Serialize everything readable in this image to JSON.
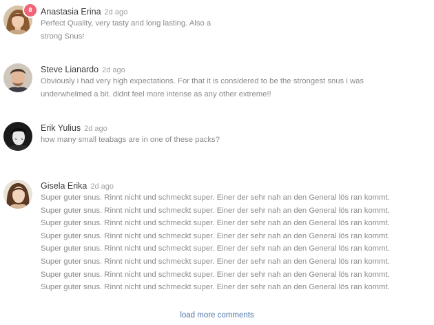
{
  "comments": [
    {
      "author": "Anastasia Erina",
      "time": "2d ago",
      "badge": "8",
      "avatar_icon": "woman-avatar-icon",
      "lines": [
        "Perfect Quality, very tasty and long lasting. Also a",
        "strong Snus!"
      ]
    },
    {
      "author": "Steve Lianardo",
      "time": "2d ago",
      "avatar_icon": "man-avatar-icon",
      "lines": [
        "Obviously i had very high expectations. For that it is considered to be the strongest snus i was",
        "underwhelmed a bit. didnt feel more intense as any other extreme!!"
      ]
    },
    {
      "author": "Erik Yulius",
      "time": "2d ago",
      "avatar_icon": "man-avatar-icon",
      "lines": [
        "how many small teabags are in one of these packs?"
      ]
    },
    {
      "author": "Gisela Erika",
      "time": "2d ago",
      "avatar_icon": "woman-avatar-icon",
      "lines": [
        "Super guter snus. Rinnt nicht und schmeckt super. Einer der sehr nah an den General lös ran kommt.",
        "Super guter snus. Rinnt nicht und schmeckt super. Einer der sehr nah an den General lös ran kommt.",
        "Super guter snus. Rinnt nicht und schmeckt super. Einer der sehr nah an den General lös ran kommt.",
        "Super guter snus. Rinnt nicht und schmeckt super. Einer der sehr nah an den General lös ran kommt.",
        "Super guter snus. Rinnt nicht und schmeckt super. Einer der sehr nah an den General lös ran kommt.",
        "Super guter snus. Rinnt nicht und schmeckt super. Einer der sehr nah an den General lös ran kommt.",
        "Super guter snus. Rinnt nicht und schmeckt super. Einer der sehr nah an den General lös ran kommt.",
        "Super guter snus. Rinnt nicht und schmeckt super. Einer der sehr nah an den General lös ran kommt."
      ]
    }
  ],
  "load_more": "load more comments",
  "colors": {
    "author": "#3b3b3b",
    "time": "#a0a0a0",
    "text": "#8a8a8a",
    "badge": "#f06475",
    "link": "#4a73a6"
  }
}
